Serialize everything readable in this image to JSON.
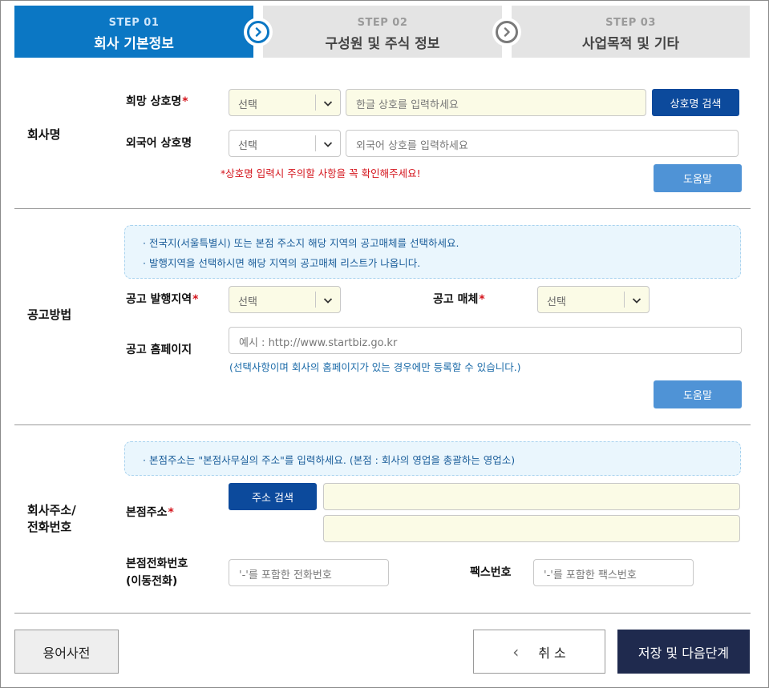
{
  "steps": [
    {
      "num": "STEP 01",
      "title": "회사 기본정보"
    },
    {
      "num": "STEP 02",
      "title": "구성원 및 주식 정보"
    },
    {
      "num": "STEP 03",
      "title": "사업목적 및 기타"
    }
  ],
  "company_name": {
    "section_label": "회사명",
    "desired_label": "희망 상호명",
    "desired_select": "선택",
    "desired_placeholder": "한글 상호를 입력하세요",
    "search_button": "상호명 검색",
    "foreign_label": "외국어 상호명",
    "foreign_select": "선택",
    "foreign_placeholder": "외국어 상호를 입력하세요",
    "warning": "*상호명 입력시 주의할 사항을 꼭 확인해주세요!",
    "help_button": "도움말"
  },
  "announcement": {
    "section_label": "공고방법",
    "notice_lines": [
      "· 전국지(서울특별시) 또는 본점 주소지 해당 지역의 공고매체를 선택하세요.",
      "· 발행지역을 선택하시면 해당 지역의 공고매체 리스트가 나옵니다."
    ],
    "region_label": "공고 발행지역",
    "region_select": "선택",
    "media_label": "공고 매체",
    "media_select": "선택",
    "homepage_label": "공고 홈페이지",
    "homepage_placeholder": "예시 : http://www.startbiz.go.kr",
    "homepage_hint": "(선택사항이며 회사의 홈페이지가 있는 경우에만 등록할 수 있습니다.)",
    "help_button": "도움말"
  },
  "address": {
    "section_label_1": "회사주소/",
    "section_label_2": "전화번호",
    "notice": "· 본점주소는 \"본점사무실의 주소\"를 입력하세요. (본점 : 회사의 영업을 총괄하는 영업소)",
    "hq_label": "본점주소",
    "search_button": "주소 검색",
    "phone_label_1": "본점전화번호",
    "phone_label_2": "(이동전화)",
    "phone_placeholder": "'-'를 포함한 전화번호",
    "fax_label": "팩스번호",
    "fax_placeholder": "'-'를 포함한 팩스번호"
  },
  "footer": {
    "dictionary": "용어사전",
    "cancel": "취 소",
    "cancel_arrow": "‹",
    "save_next": "저장 및 다음단계"
  },
  "colors": {
    "active_step": "#0b77c4",
    "navy_button": "#0c4a9c",
    "light_button": "#4f93d6",
    "save_button": "#1f2a4e",
    "required": "#d4131b"
  }
}
